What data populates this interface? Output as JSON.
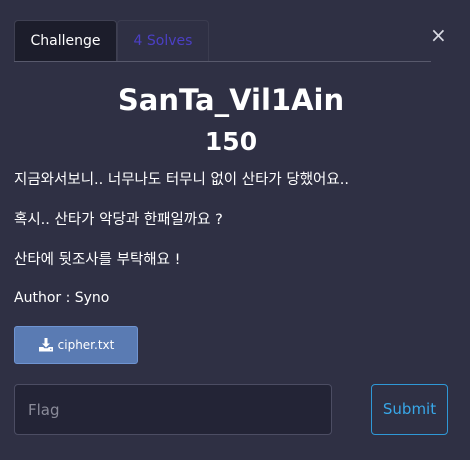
{
  "tabs": [
    {
      "label": "Challenge"
    },
    {
      "label": "4 Solves"
    }
  ],
  "close_label": "×",
  "challenge": {
    "title": "SanTa_Vil1Ain",
    "value": "150",
    "description": [
      "지금와서보니.. 너무나도 터무니 없이 산타가 당했어요..",
      "혹시.. 산타가 악당과 한패일까요 ?",
      "산타에 뒷조사를 부탁해요 !"
    ],
    "author": "Author : Syno",
    "file": {
      "name": "cipher.txt",
      "icon": "download-icon"
    }
  },
  "form": {
    "flag_placeholder": "Flag",
    "flag_value": "",
    "submit_label": "Submit"
  },
  "colors": {
    "background": "#2f3044",
    "tab_active_bg": "#1c1d2b",
    "tab_inactive_text": "#4b3fc4",
    "file_button_bg": "#5a7bb3",
    "input_bg": "#232436",
    "submit_accent": "#38a7e8"
  }
}
